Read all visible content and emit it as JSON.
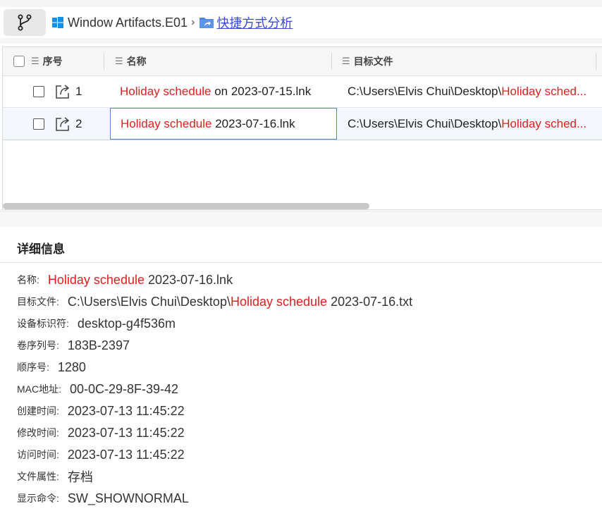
{
  "breadcrumb": {
    "root": "Window Artifacts.E01",
    "separator": "›",
    "current": "快捷方式分析"
  },
  "columns": {
    "index": "序号",
    "name": "名称",
    "target": "目标文件"
  },
  "rows": [
    {
      "index": "1",
      "name_highlight": "Holiday schedule",
      "name_rest": " on 2023-07-15.lnk",
      "target_prefix": "C:\\Users\\Elvis Chui\\Desktop\\",
      "target_highlight": "Holiday sched..."
    },
    {
      "index": "2",
      "name_highlight": "Holiday schedule",
      "name_rest": " 2023-07-16.lnk",
      "target_prefix": "C:\\Users\\Elvis Chui\\Desktop\\",
      "target_highlight": "Holiday sched..."
    }
  ],
  "details": {
    "title": "详细信息",
    "name_label": "名称:",
    "name_highlight": "Holiday schedule",
    "name_rest": " 2023-07-16.lnk",
    "target_label": "目标文件:",
    "target_prefix": "C:\\Users\\Elvis Chui\\Desktop\\",
    "target_highlight": "Holiday schedule",
    "target_rest": " 2023-07-16.txt",
    "device_label": "设备标识符:",
    "device_value": "desktop-g4f536m",
    "volume_label": "卷序列号:",
    "volume_value": "183B-2397",
    "seq_label": "顺序号:",
    "seq_value": "1280",
    "mac_label": "MAC地址:",
    "mac_value": "00-0C-29-8F-39-42",
    "created_label": "创建时间:",
    "created_value": "2023-07-13 11:45:22",
    "modified_label": "修改时间:",
    "modified_value": "2023-07-13 11:45:22",
    "accessed_label": "访问时间:",
    "accessed_value": "2023-07-13 11:45:22",
    "attr_label": "文件属性:",
    "attr_value": "存档",
    "cmd_label": "显示命令:",
    "cmd_value": "SW_SHOWNORMAL"
  },
  "colors": {
    "highlight": "#e02020",
    "link": "#3a4bd8",
    "selection_border": "#5b83c9"
  },
  "icons": {
    "branch": "git-branch-icon",
    "windows": "windows-logo-icon",
    "folder": "shortcut-folder-icon",
    "open": "open-external-icon",
    "menu": "column-menu-icon"
  }
}
